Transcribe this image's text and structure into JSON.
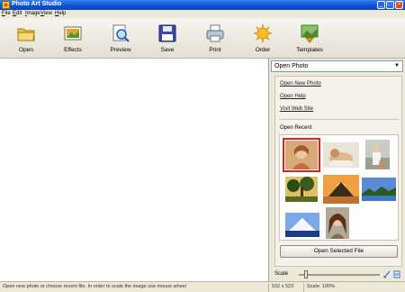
{
  "window": {
    "title": "Photo Art Studio",
    "minimize": "_",
    "maximize": "□",
    "close": "×"
  },
  "menu": [
    {
      "label": "File",
      "accel": "F",
      "rest": "ile"
    },
    {
      "label": "Edit",
      "accel": "E",
      "rest": "dit"
    },
    {
      "label": "Image",
      "accel": "I",
      "rest": "mage"
    },
    {
      "label": "View",
      "accel": "V",
      "rest": "iew"
    },
    {
      "label": "Help",
      "accel": "H",
      "rest": "elp"
    }
  ],
  "toolbar": [
    {
      "label": "Open",
      "icon": "folder-icon"
    },
    {
      "label": "Effects",
      "icon": "effects-icon"
    },
    {
      "label": "Preview",
      "icon": "preview-icon"
    },
    {
      "label": "Save",
      "icon": "floppy-icon"
    },
    {
      "label": "Print",
      "icon": "printer-icon"
    },
    {
      "label": "Order",
      "icon": "sun-icon"
    },
    {
      "label": "Templates",
      "icon": "templates-icon"
    }
  ],
  "panel": {
    "mode": "Open Photo",
    "links": {
      "open_new": "Open New Photo",
      "open_help": "Open Help",
      "visit_site": "Visit Web Site"
    },
    "recent_label": "Open Recent",
    "open_selected": "Open Selected File",
    "scale_label": "Scale"
  },
  "status": {
    "hint": "Open new photo or choose recent file. In order to scale the image use mouse wheel",
    "dimensions": "532 x 523",
    "scale": "Scale: 100%"
  },
  "colors": {
    "title_bar": "#0a4fd6",
    "selection": "#e02020"
  }
}
